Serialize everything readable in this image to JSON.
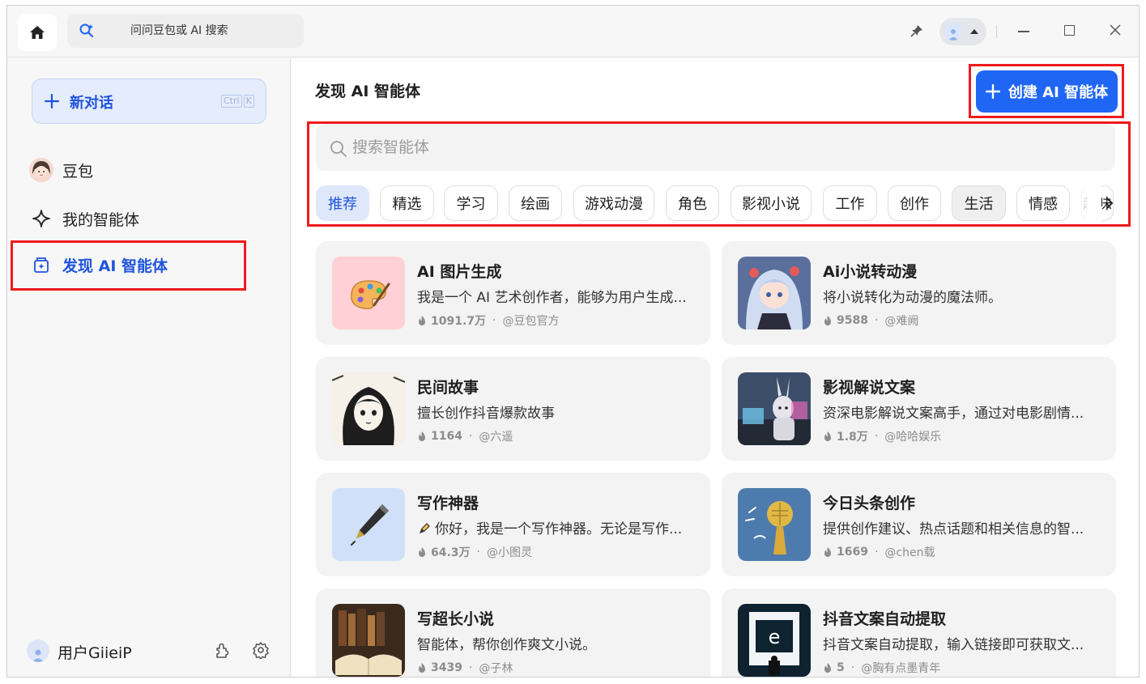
{
  "topbar": {
    "search_placeholder": "问问豆包或 AI 搜索"
  },
  "sidebar": {
    "new_chat_label": "新对话",
    "shortcut_keys": [
      "Ctrl",
      "K"
    ],
    "items": [
      {
        "label": "豆包"
      },
      {
        "label": "我的智能体"
      },
      {
        "label": "发现 AI 智能体"
      }
    ],
    "user_name": "用户GiieiP"
  },
  "main": {
    "title": "发现 AI 智能体",
    "create_label": "创建 AI 智能体",
    "search_placeholder": "搜索智能体",
    "categories": [
      "推荐",
      "精选",
      "学习",
      "绘画",
      "游戏动漫",
      "角色",
      "影视小说",
      "工作",
      "创作",
      "生活",
      "情感",
      "趣味"
    ],
    "active_category": "推荐",
    "agents": [
      {
        "title": "AI 图片生成",
        "desc": "我是一个 AI 艺术创作者，能够为用户生成...",
        "count": "1091.7万",
        "author": "@豆包官方"
      },
      {
        "title": "Ai小说转动漫",
        "desc": "将小说转化为动漫的魔法师。",
        "count": "9588",
        "author": "@难阙"
      },
      {
        "title": "民间故事",
        "desc": "擅长创作抖音爆款故事",
        "count": "1164",
        "author": "@六遥"
      },
      {
        "title": "影视解说文案",
        "desc": "资深电影解说文案高手，通过对电影剧情...",
        "count": "1.8万",
        "author": "@哈哈娱乐"
      },
      {
        "title": "写作神器",
        "desc": "你好，我是一个写作神器。无论是写作...",
        "count": "64.3万",
        "author": "@小图灵"
      },
      {
        "title": "今日头条创作",
        "desc": "提供创作建议、热点话题和相关信息的智...",
        "count": "1669",
        "author": "@chen载"
      },
      {
        "title": "写超长小说",
        "desc": "智能体，帮你创作爽文小说。",
        "count": "3439",
        "author": "@子林"
      },
      {
        "title": "抖音文案自动提取",
        "desc": "抖音文案自动提取，输入链接即可获取文...",
        "count": "5",
        "author": "@胸有点墨青年"
      }
    ]
  },
  "colors": {
    "accent": "#1f66f5",
    "accent_text": "#1f54dc",
    "highlight": "#ee1b1b"
  }
}
